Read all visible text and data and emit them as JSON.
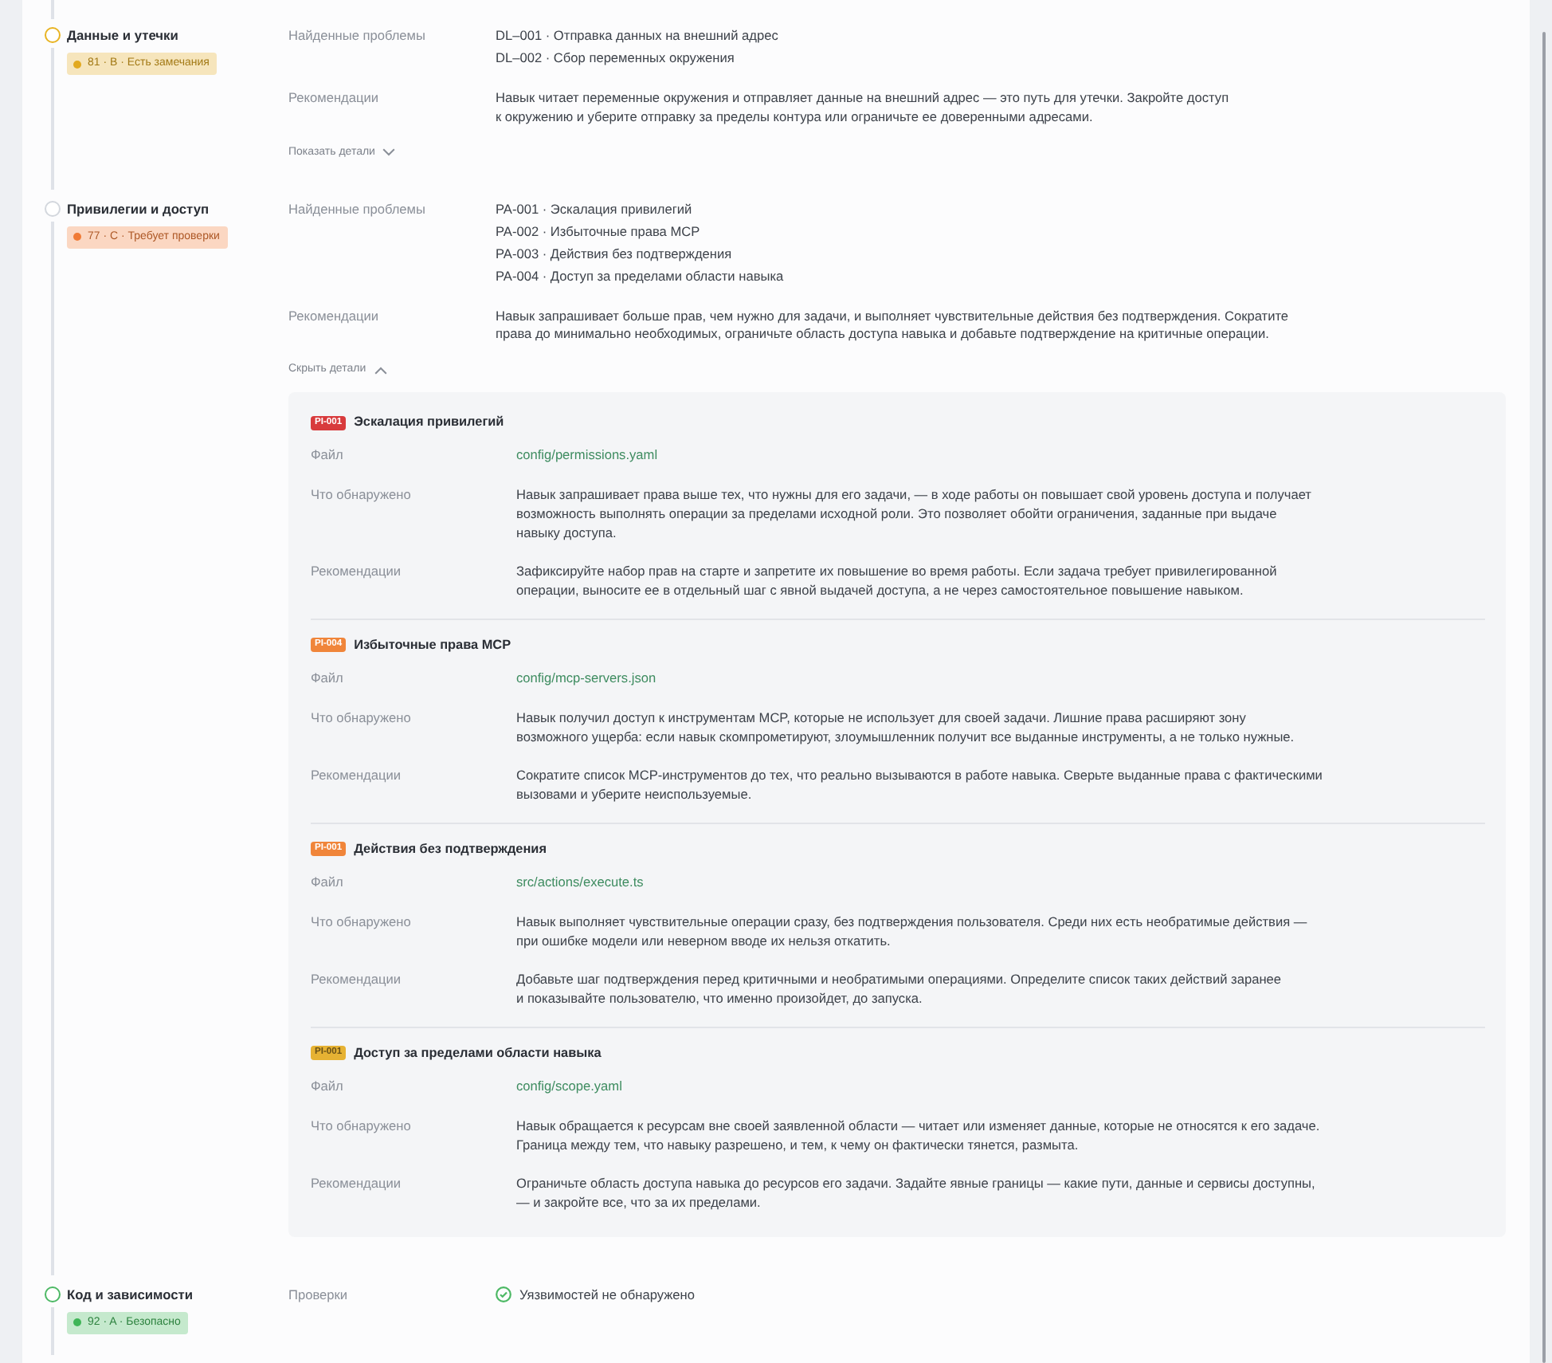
{
  "sections": [
    {
      "title": "Данные и утечки",
      "marker": {
        "color": "#e8b321"
      },
      "badge": {
        "text": "81 · B · Есть замечания",
        "color": "#e2a91f"
      },
      "rows": [
        {
          "kind": "list",
          "label": "Найденные проблемы",
          "items": [
            "DL–001 · Отправка данных на внешний адрес",
            "DL–002 · Сбор переменных окружения"
          ]
        },
        {
          "kind": "text",
          "label": "Рекомендации",
          "text": "Навык читает переменные окружения и отправляет данные на внешний адрес — это путь для утечки. Закройте доступ\nк окружению и уберите отправку за пределы контура или ограничьте ее доверенными адресами."
        }
      ],
      "toggle": {
        "label": "Показать детали",
        "expanded": false
      }
    },
    {
      "title": "Привилегии и доступ",
      "marker": {
        "color": "#d3d7dd"
      },
      "badge": {
        "text": "77 · C · Требует проверки",
        "color": "#f07a35"
      },
      "rows": [
        {
          "kind": "list",
          "label": "Найденные проблемы",
          "items": [
            "PA-001 · Эскалация привилегий",
            "PA-002 · Избыточные права MCP",
            "PA-003 · Действия без подтверждения",
            "PA-004 · Доступ за пределами области навыка"
          ]
        },
        {
          "kind": "text",
          "label": "Рекомендации",
          "text": "Навык запрашивает больше прав, чем нужно для задачи, и выполняет чувствительные действия без подтверждения. Сократите\nправа до минимально необходимых, ограничьте область доступа навыка и добавьте подтверждение на критичные операции."
        }
      ],
      "toggle": {
        "label": "Скрыть детали",
        "expanded": true
      },
      "details": [
        {
          "tag": {
            "text": "PI-001",
            "color": "#d83a3c"
          },
          "title": "Эскалация привилегий",
          "fields": [
            {
              "kind": "file",
              "label": "Файл",
              "value": "config/permissions.yaml"
            },
            {
              "kind": "text",
              "label": "Что обнаружено",
              "value": "Навык запрашивает права выше тех, что нужны для его задачи, — в ходе работы он повышает свой уровень доступа и получает\nвозможность выполнять операции за пределами исходной роли. Это позволяет обойти ограничения, заданные при выдаче\nнавыку доступа."
            },
            {
              "kind": "text",
              "label": "Рекомендации",
              "value": "Зафиксируйте набор прав на старте и запретите их повышение во время работы. Если задача требует привилегированной\nоперации, выносите ее в отдельный шаг с явной выдачей доступа, а не через самостоятельное повышение навыком."
            }
          ]
        },
        {
          "tag": {
            "text": "PI-004",
            "color": "#f0853a"
          },
          "title": "Избыточные права MCP",
          "fields": [
            {
              "kind": "file",
              "label": "Файл",
              "value": "config/mcp-servers.json"
            },
            {
              "kind": "text",
              "label": "Что обнаружено",
              "value": "Навык получил доступ к инструментам MCP, которые не использует для своей задачи. Лишние права расширяют зону\nвозможного ущерба: если навык скомпрометируют, злоумышленник получит все выданные инструменты, а не только нужные."
            },
            {
              "kind": "text",
              "label": "Рекомендации",
              "value": "Сократите список MCP-инструментов до тех, что реально вызываются в работе навыка. Сверьте выданные права с фактическими\nвызовами и уберите неиспользуемые."
            }
          ]
        },
        {
          "tag": {
            "text": "PI-001",
            "color": "#f0853a"
          },
          "title": "Действия без подтверждения",
          "fields": [
            {
              "kind": "file",
              "label": "Файл",
              "value": "src/actions/execute.ts"
            },
            {
              "kind": "text",
              "label": "Что обнаружено",
              "value": "Навык выполняет чувствительные операции сразу, без подтверждения пользователя. Среди них есть необратимые действия —\nпри ошибке модели или неверном вводе их нельзя откатить."
            },
            {
              "kind": "text",
              "label": "Рекомендации",
              "value": "Добавьте шаг подтверждения перед критичными и необратимыми операциями. Определите список таких действий заранее\nи показывайте пользователю, что именно произойдет, до запуска."
            }
          ]
        },
        {
          "tag": {
            "text": "PI-001",
            "color": "#e6b233"
          },
          "title": "Доступ за пределами области навыка",
          "fields": [
            {
              "kind": "file",
              "label": "Файл",
              "value": "config/scope.yaml"
            },
            {
              "kind": "text",
              "label": "Что обнаружено",
              "value": "Навык обращается к ресурсам вне своей заявленной области — читает или изменяет данные, которые не относятся к его задаче.\nГраница между тем, что навыку разрешено, и тем, к чему он фактически тянется, размыта."
            },
            {
              "kind": "text",
              "label": "Рекомендации",
              "value": "Ограничьте область доступа навыка до ресурсов его задачи. Задайте явные границы — какие пути, данные и сервисы доступны,\n— и закройте все, что за их пределами."
            }
          ]
        }
      ]
    },
    {
      "title": "Код и зависимости",
      "marker": {
        "color": "#4cb864"
      },
      "badge": {
        "text": "92 · A · Безопасно",
        "color": "#3fb557"
      },
      "rows": [
        {
          "kind": "check",
          "label": "Проверки",
          "text": "Уязвимостей не обнаружено"
        }
      ]
    }
  ]
}
